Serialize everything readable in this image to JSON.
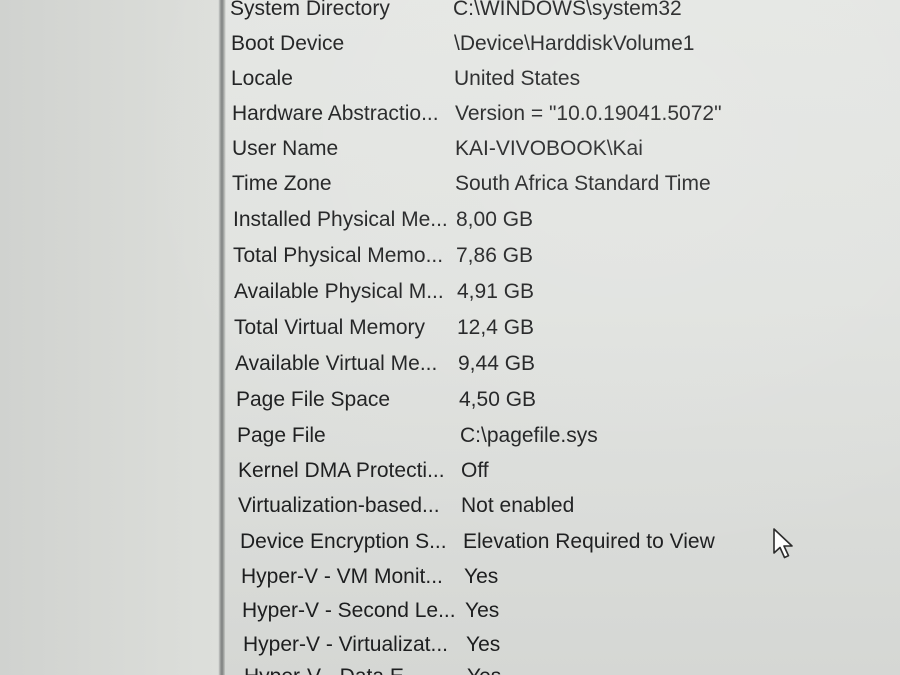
{
  "system_summary": {
    "rows": [
      {
        "item": "System Directory",
        "value": "C:\\WINDOWS\\system32"
      },
      {
        "item": "Boot Device",
        "value": "\\Device\\HarddiskVolume1"
      },
      {
        "item": "Locale",
        "value": "United States"
      },
      {
        "item": "Hardware Abstractio...",
        "value": "Version = \"10.0.19041.5072\""
      },
      {
        "item": "User Name",
        "value": "KAI-VIVOBOOK\\Kai"
      },
      {
        "item": "Time Zone",
        "value": "South Africa Standard Time"
      },
      {
        "item": "Installed Physical Me...",
        "value": "8,00 GB"
      },
      {
        "item": "Total Physical Memo...",
        "value": "7,86 GB"
      },
      {
        "item": "Available Physical M...",
        "value": "4,91 GB"
      },
      {
        "item": "Total Virtual Memory",
        "value": "12,4 GB"
      },
      {
        "item": "Available Virtual Me...",
        "value": "9,44 GB"
      },
      {
        "item": "Page File Space",
        "value": "4,50 GB"
      },
      {
        "item": "Page File",
        "value": "C:\\pagefile.sys"
      },
      {
        "item": "Kernel DMA Protecti...",
        "value": "Off"
      },
      {
        "item": "Virtualization-based...",
        "value": "Not enabled"
      },
      {
        "item": "Device Encryption S...",
        "value": "Elevation Required to View"
      },
      {
        "item": "Hyper-V - VM Monit...",
        "value": "Yes"
      },
      {
        "item": "Hyper-V - Second Le...",
        "value": "Yes"
      },
      {
        "item": "Hyper-V - Virtualizat...",
        "value": "Yes"
      },
      {
        "item": "Hyper-V - Data E...",
        "value": "Yes"
      }
    ]
  },
  "cursor": {
    "icon": "mouse-pointer-icon"
  }
}
